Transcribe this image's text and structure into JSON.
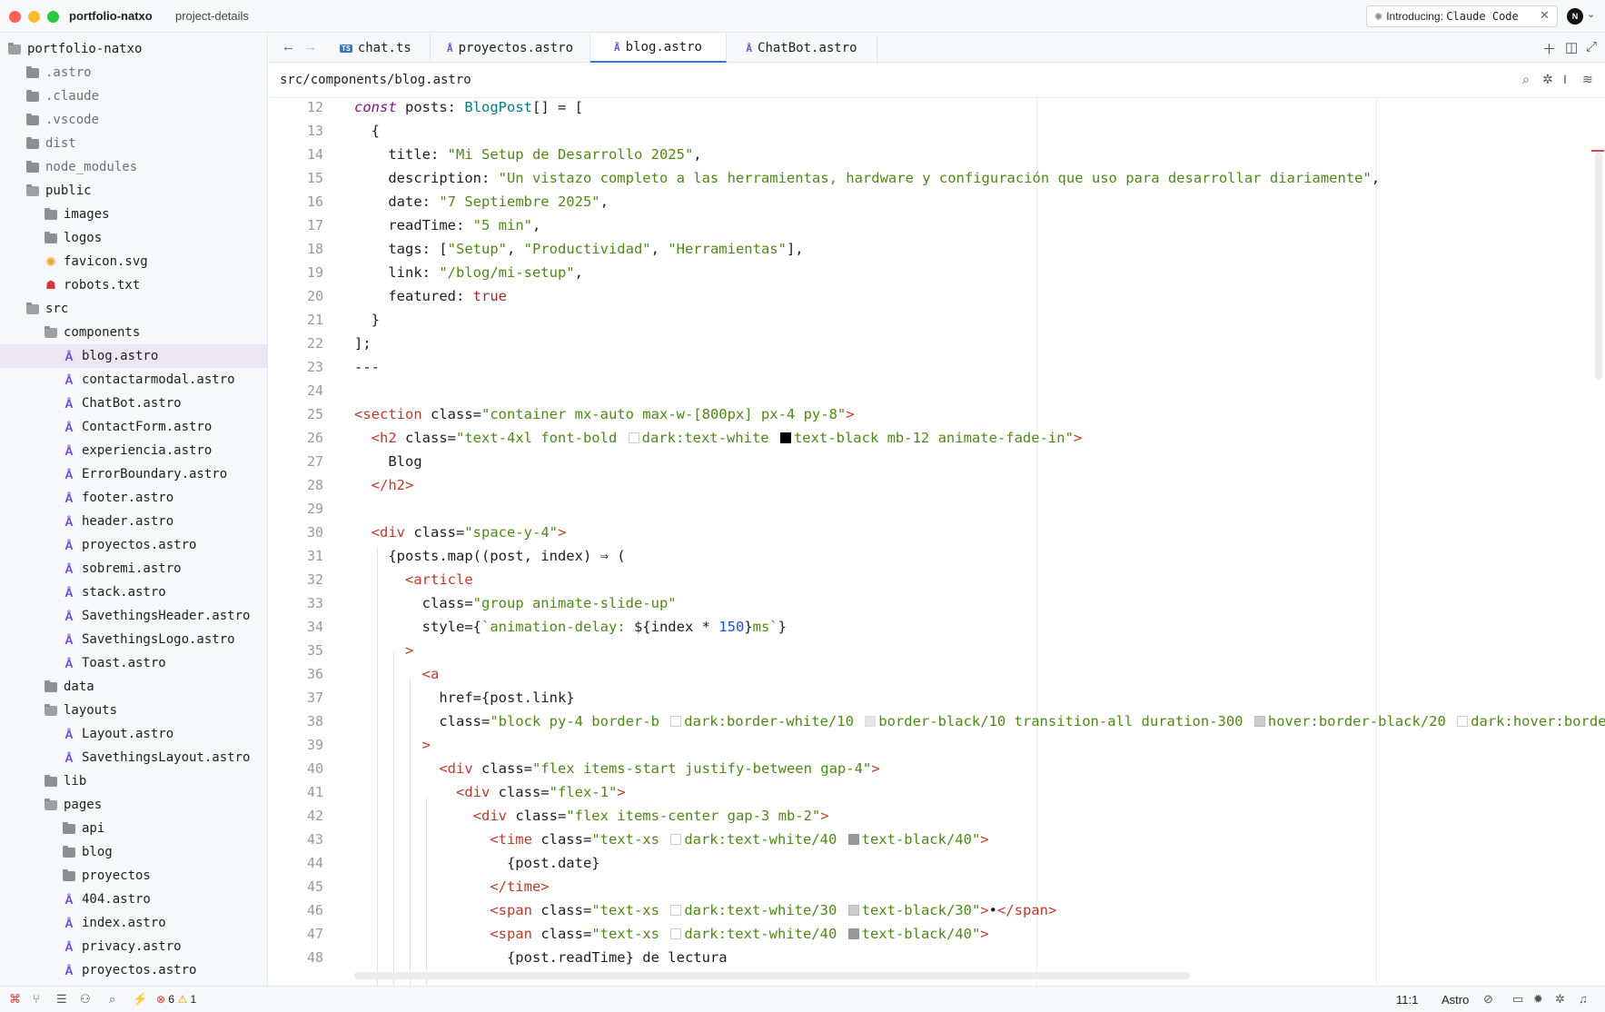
{
  "titlebar": {
    "project": "portfolio-natxo",
    "branch": "project-details",
    "intro_prefix": "Introducing:",
    "intro_product": "Claude Code",
    "avatar_initial": "N"
  },
  "sidebar": {
    "root": "portfolio-natxo",
    "items": [
      {
        "label": ".astro",
        "type": "folder",
        "depth": 1
      },
      {
        "label": ".claude",
        "type": "folder",
        "depth": 1
      },
      {
        "label": ".vscode",
        "type": "folder",
        "depth": 1
      },
      {
        "label": "dist",
        "type": "folder",
        "depth": 1
      },
      {
        "label": "node_modules",
        "type": "folder",
        "depth": 1
      },
      {
        "label": "public",
        "type": "folder-open",
        "depth": 1
      },
      {
        "label": "images",
        "type": "folder",
        "depth": 2
      },
      {
        "label": "logos",
        "type": "folder",
        "depth": 2
      },
      {
        "label": "favicon.svg",
        "type": "svg",
        "depth": 2
      },
      {
        "label": "robots.txt",
        "type": "robots",
        "depth": 2
      },
      {
        "label": "src",
        "type": "folder-open",
        "depth": 1
      },
      {
        "label": "components",
        "type": "folder-open",
        "depth": 2
      },
      {
        "label": "blog.astro",
        "type": "astro",
        "depth": 3,
        "selected": true
      },
      {
        "label": "contactarmodal.astro",
        "type": "astro",
        "depth": 3
      },
      {
        "label": "ChatBot.astro",
        "type": "astro",
        "depth": 3
      },
      {
        "label": "ContactForm.astro",
        "type": "astro",
        "depth": 3
      },
      {
        "label": "experiencia.astro",
        "type": "astro",
        "depth": 3
      },
      {
        "label": "ErrorBoundary.astro",
        "type": "astro",
        "depth": 3
      },
      {
        "label": "footer.astro",
        "type": "astro",
        "depth": 3
      },
      {
        "label": "header.astro",
        "type": "astro",
        "depth": 3
      },
      {
        "label": "proyectos.astro",
        "type": "astro",
        "depth": 3
      },
      {
        "label": "sobremi.astro",
        "type": "astro",
        "depth": 3
      },
      {
        "label": "stack.astro",
        "type": "astro",
        "depth": 3
      },
      {
        "label": "SavethingsHeader.astro",
        "type": "astro",
        "depth": 3
      },
      {
        "label": "SavethingsLogo.astro",
        "type": "astro",
        "depth": 3
      },
      {
        "label": "Toast.astro",
        "type": "astro",
        "depth": 3
      },
      {
        "label": "data",
        "type": "folder",
        "depth": 2
      },
      {
        "label": "layouts",
        "type": "folder-open",
        "depth": 2
      },
      {
        "label": "Layout.astro",
        "type": "astro",
        "depth": 3
      },
      {
        "label": "SavethingsLayout.astro",
        "type": "astro",
        "depth": 3
      },
      {
        "label": "lib",
        "type": "folder",
        "depth": 2
      },
      {
        "label": "pages",
        "type": "folder-open",
        "depth": 2
      },
      {
        "label": "api",
        "type": "folder",
        "depth": 3
      },
      {
        "label": "blog",
        "type": "folder",
        "depth": 3
      },
      {
        "label": "proyectos",
        "type": "folder",
        "depth": 3
      },
      {
        "label": "404.astro",
        "type": "astro",
        "depth": 3
      },
      {
        "label": "index.astro",
        "type": "astro",
        "depth": 3
      },
      {
        "label": "privacy.astro",
        "type": "astro",
        "depth": 3
      },
      {
        "label": "proyectos.astro",
        "type": "astro",
        "depth": 3
      }
    ]
  },
  "tabs": [
    {
      "label": "chat.ts",
      "icon": "ts",
      "active": false
    },
    {
      "label": "proyectos.astro",
      "icon": "astro",
      "active": false
    },
    {
      "label": "blog.astro",
      "icon": "astro",
      "active": true
    },
    {
      "label": "ChatBot.astro",
      "icon": "astro",
      "active": false
    }
  ],
  "breadcrumb": "src/components/blog.astro",
  "editor": {
    "lines": [
      {
        "n": "12",
        "html": "<span class=\"kwi\">const</span> posts: <span class=\"typ\">BlogPost</span>[] = ["
      },
      {
        "n": "13",
        "html": "  {"
      },
      {
        "n": "14",
        "html": "    title: <span class=\"str\">\"Mi Setup de Desarrollo 2025\"</span>,"
      },
      {
        "n": "15",
        "html": "    description: <span class=\"str\">\"Un vistazo completo a las herramientas, hardware y configuración que uso para desarrollar diariamente\"</span>,"
      },
      {
        "n": "16",
        "html": "    date: <span class=\"str\">\"7 Septiembre 2025\"</span>,"
      },
      {
        "n": "17",
        "html": "    readTime: <span class=\"str\">\"5 min\"</span>,"
      },
      {
        "n": "18",
        "html": "    tags: [<span class=\"str\">\"Setup\"</span>, <span class=\"str\">\"Productividad\"</span>, <span class=\"str\">\"Herramientas\"</span>],"
      },
      {
        "n": "19",
        "html": "    link: <span class=\"str\">\"/blog/mi-setup\"</span>,"
      },
      {
        "n": "20",
        "html": "    featured: <span class=\"bool\">true</span>"
      },
      {
        "n": "21",
        "html": "  }"
      },
      {
        "n": "22",
        "html": "];"
      },
      {
        "n": "23",
        "html": "---"
      },
      {
        "n": "24",
        "html": ""
      },
      {
        "n": "25",
        "html": "<span class=\"tag\">&lt;section</span> class=<span class=\"str\">\"container mx-auto max-w-[800px] px-4 py-8\"</span><span class=\"tag\">&gt;</span>"
      },
      {
        "n": "26",
        "html": "  <span class=\"tag\">&lt;h2</span> class=<span class=\"str\">\"text-4xl font-bold <span class=\"swatch sw-white\"></span>dark:text-white <span class=\"swatch sw-black\"></span>text-black mb-12 animate-fade-in\"</span><span class=\"tag\">&gt;</span>"
      },
      {
        "n": "27",
        "html": "    Blog"
      },
      {
        "n": "28",
        "html": "  <span class=\"tag\">&lt;/h2&gt;</span>"
      },
      {
        "n": "29",
        "html": ""
      },
      {
        "n": "30",
        "html": "  <span class=\"tag\">&lt;div</span> class=<span class=\"str\">\"space-y-4\"</span><span class=\"tag\">&gt;</span>"
      },
      {
        "n": "31",
        "html": "    {posts.map((post, index) ⇒ ("
      },
      {
        "n": "32",
        "html": "      <span class=\"tag\">&lt;article</span>"
      },
      {
        "n": "33",
        "html": "        class=<span class=\"str\">\"group animate-slide-up\"</span>"
      },
      {
        "n": "34",
        "html": "        style={<span class=\"str\">`animation-delay: </span>${index * <span class=\"num\">150</span>}<span class=\"str\">ms`</span>}"
      },
      {
        "n": "35",
        "html": "      <span class=\"tag\">&gt;</span>"
      },
      {
        "n": "36",
        "html": "        <span class=\"tag\">&lt;a</span>"
      },
      {
        "n": "37",
        "html": "          href={post.link}"
      },
      {
        "n": "38",
        "html": "          class=<span class=\"str\">\"block py-4 border-b <span class=\"swatch sw-white\"></span>dark:border-white/10 <span class=\"swatch sw-grey10\"></span>border-black/10 transition-all duration-300 <span class=\"swatch sw-grey20\"></span>hover:border-black/20 <span class=\"swatch sw-white\"></span>dark:hover:border</span>"
      },
      {
        "n": "39",
        "html": "        <span class=\"tag\">&gt;</span>"
      },
      {
        "n": "40",
        "html": "          <span class=\"tag\">&lt;div</span> class=<span class=\"str\">\"flex items-start justify-between gap-4\"</span><span class=\"tag\">&gt;</span>"
      },
      {
        "n": "41",
        "html": "            <span class=\"tag\">&lt;div</span> class=<span class=\"str\">\"flex-1\"</span><span class=\"tag\">&gt;</span>"
      },
      {
        "n": "42",
        "html": "              <span class=\"tag\">&lt;div</span> class=<span class=\"str\">\"flex items-center gap-3 mb-2\"</span><span class=\"tag\">&gt;</span>"
      },
      {
        "n": "43",
        "html": "                <span class=\"tag\">&lt;time</span> class=<span class=\"str\">\"text-xs <span class=\"swatch sw-white\"></span>dark:text-white/40 <span class=\"swatch sw-grey40\"></span>text-black/40\"</span><span class=\"tag\">&gt;</span>"
      },
      {
        "n": "44",
        "html": "                  {post.date}"
      },
      {
        "n": "45",
        "html": "                <span class=\"tag\">&lt;/time&gt;</span>"
      },
      {
        "n": "46",
        "html": "                <span class=\"tag\">&lt;span</span> class=<span class=\"str\">\"text-xs <span class=\"swatch sw-white\"></span>dark:text-white/30 <span class=\"swatch sw-grey20\"></span>text-black/30\"</span><span class=\"tag\">&gt;</span>•<span class=\"tag\">&lt;/span&gt;</span>"
      },
      {
        "n": "47",
        "html": "                <span class=\"tag\">&lt;span</span> class=<span class=\"str\">\"text-xs <span class=\"swatch sw-white\"></span>dark:text-white/40 <span class=\"swatch sw-grey40\"></span>text-black/40\"</span><span class=\"tag\">&gt;</span>"
      },
      {
        "n": "48",
        "html": "                  {post.readTime} de lectura"
      }
    ]
  },
  "statusbar": {
    "errors": "6",
    "warnings": "1",
    "cursor": "11:1",
    "language": "Astro"
  },
  "colors": {
    "accent": "#3574f0",
    "astro_icon": "#6b4fd8",
    "error": "#d03a3a",
    "warning": "#d69b00"
  }
}
